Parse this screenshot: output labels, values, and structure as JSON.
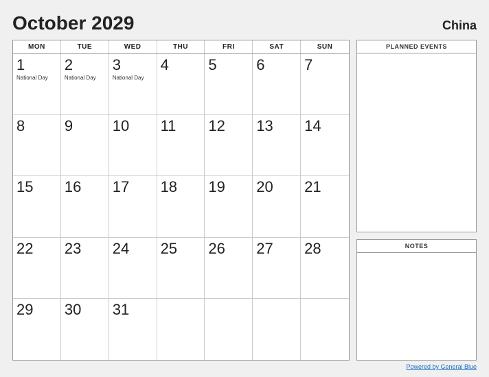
{
  "header": {
    "title": "October 2029",
    "country": "China"
  },
  "day_headers": [
    "MON",
    "TUE",
    "WED",
    "THU",
    "FRI",
    "SAT",
    "SUN"
  ],
  "weeks": [
    [
      {
        "day": "1",
        "events": [
          "National Day"
        ]
      },
      {
        "day": "2",
        "events": [
          "National Day"
        ]
      },
      {
        "day": "3",
        "events": [
          "National Day"
        ]
      },
      {
        "day": "4",
        "events": []
      },
      {
        "day": "5",
        "events": []
      },
      {
        "day": "6",
        "events": []
      },
      {
        "day": "7",
        "events": []
      }
    ],
    [
      {
        "day": "8",
        "events": []
      },
      {
        "day": "9",
        "events": []
      },
      {
        "day": "10",
        "events": []
      },
      {
        "day": "11",
        "events": []
      },
      {
        "day": "12",
        "events": []
      },
      {
        "day": "13",
        "events": []
      },
      {
        "day": "14",
        "events": []
      }
    ],
    [
      {
        "day": "15",
        "events": []
      },
      {
        "day": "16",
        "events": []
      },
      {
        "day": "17",
        "events": []
      },
      {
        "day": "18",
        "events": []
      },
      {
        "day": "19",
        "events": []
      },
      {
        "day": "20",
        "events": []
      },
      {
        "day": "21",
        "events": []
      }
    ],
    [
      {
        "day": "22",
        "events": []
      },
      {
        "day": "23",
        "events": []
      },
      {
        "day": "24",
        "events": []
      },
      {
        "day": "25",
        "events": []
      },
      {
        "day": "26",
        "events": []
      },
      {
        "day": "27",
        "events": []
      },
      {
        "day": "28",
        "events": []
      }
    ],
    [
      {
        "day": "29",
        "events": []
      },
      {
        "day": "30",
        "events": []
      },
      {
        "day": "31",
        "events": []
      },
      {
        "day": "",
        "events": []
      },
      {
        "day": "",
        "events": []
      },
      {
        "day": "",
        "events": []
      },
      {
        "day": "",
        "events": []
      }
    ]
  ],
  "planned_events_label": "PLANNED EVENTS",
  "notes_label": "NOTES",
  "footer_link_text": "Powered by General Blue"
}
